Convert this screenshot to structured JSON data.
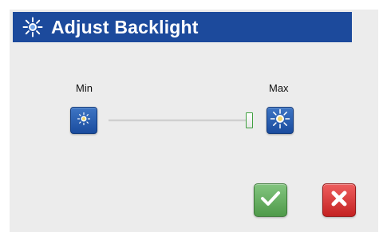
{
  "dialog": {
    "title": "Adjust Backlight",
    "title_icon": "sun-icon",
    "title_bar_color": "#1c4a9c"
  },
  "slider": {
    "min_label": "Min",
    "max_label": "Max",
    "min_button_icon": "sun-dim-icon",
    "max_button_icon": "sun-bright-icon",
    "value_fraction": 1.0
  },
  "actions": {
    "confirm_icon": "checkmark-icon",
    "confirm_color": "#5aa855",
    "cancel_icon": "close-x-icon",
    "cancel_color": "#d63a3a"
  }
}
